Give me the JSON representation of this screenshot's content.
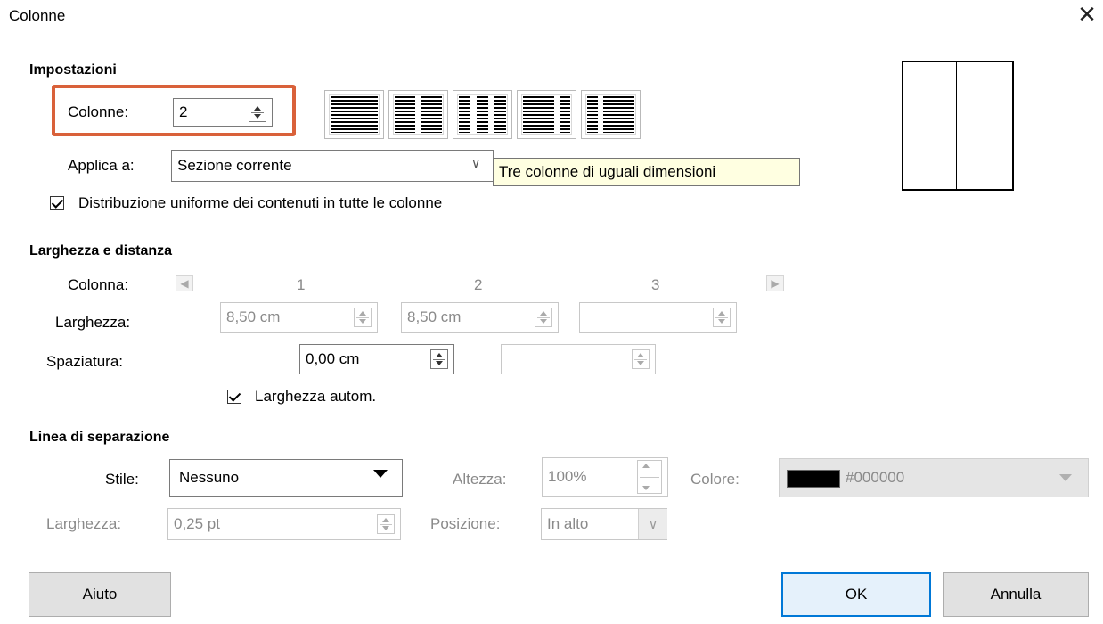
{
  "dialog": {
    "title": "Colonne"
  },
  "settings": {
    "heading": "Impostazioni",
    "columns_label": "Colonne:",
    "columns_value": "2",
    "apply_label": "Applica a:",
    "apply_value": "Sezione corrente",
    "tooltip": "Tre colonne di uguali dimensioni",
    "distribute_label": "Distribuzione uniforme dei contenuti in tutte le colonne",
    "distribute_checked": true,
    "presets": [
      "one-column",
      "two-columns",
      "three-columns",
      "two-columns-left-wide",
      "two-columns-right-wide"
    ]
  },
  "width_spacing": {
    "heading": "Larghezza e distanza",
    "column_label": "Colonna:",
    "col_numbers": [
      "1",
      "2",
      "3"
    ],
    "width_label": "Larghezza:",
    "widths": [
      "8,50 cm",
      "8,50 cm",
      ""
    ],
    "spacing_label": "Spaziatura:",
    "spacings": [
      "0,00 cm",
      ""
    ],
    "auto_width_label": "Larghezza autom.",
    "auto_width_checked": true
  },
  "separator": {
    "heading": "Linea di separazione",
    "style_label": "Stile:",
    "style_value": "Nessuno",
    "height_label": "Altezza:",
    "height_value": "100%",
    "color_label": "Colore:",
    "color_value": "#000000",
    "color_swatch": "#000000",
    "width_label": "Larghezza:",
    "width_value": "0,25 pt",
    "position_label": "Posizione:",
    "position_value": "In alto"
  },
  "buttons": {
    "help": "Aiuto",
    "ok": "OK",
    "cancel": "Annulla"
  },
  "colors": {
    "highlight": "#d9613a",
    "ok_border": "#0078d7"
  }
}
